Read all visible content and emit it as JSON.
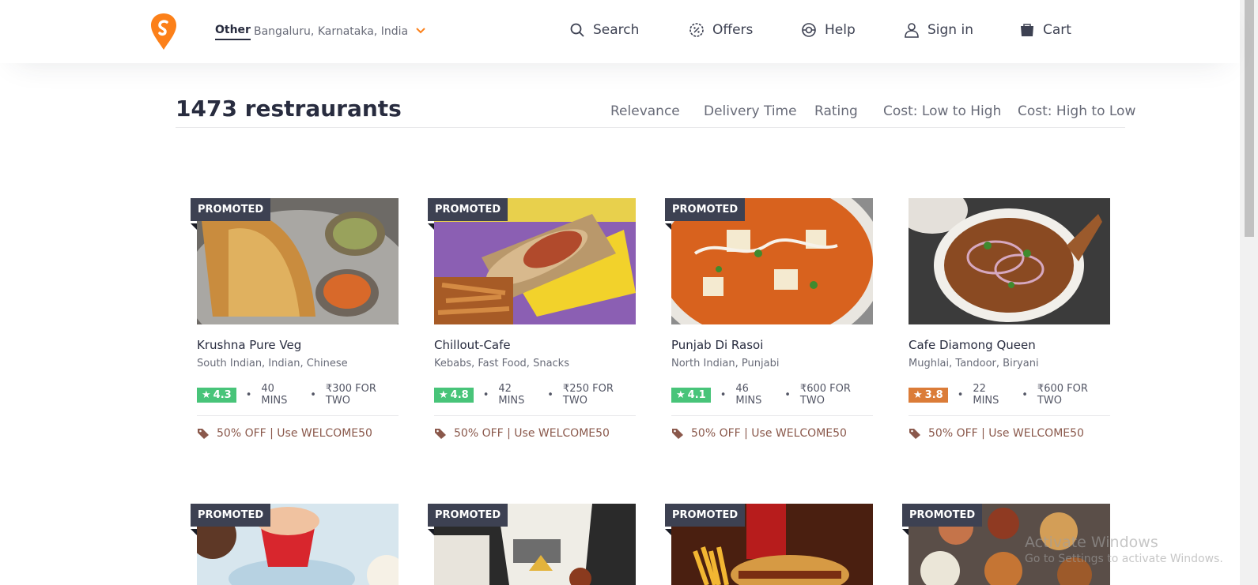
{
  "header": {
    "location_type": "Other",
    "location_text": "Bangaluru, Karnataka, India",
    "nav": [
      {
        "label": "Search",
        "icon": "search-icon"
      },
      {
        "label": "Offers",
        "icon": "offers-icon"
      },
      {
        "label": "Help",
        "icon": "help-icon"
      },
      {
        "label": "Sign in",
        "icon": "user-icon"
      },
      {
        "label": "Cart",
        "icon": "cart-icon"
      }
    ]
  },
  "listing": {
    "count_title": "1473 restraurants",
    "sort_options": [
      "Relevance",
      "Delivery Time",
      "Rating",
      "Cost: Low to High",
      "Cost: High to Low"
    ]
  },
  "colors": {
    "brand": "#fc8019",
    "rating_green": "#48c479",
    "rating_orange": "#db7c38",
    "promo_bg": "#3d4152"
  },
  "restaurants": [
    {
      "promoted_label": "PROMOTED",
      "name": "Krushna Pure Veg",
      "cuisines": "South Indian, Indian, Chinese",
      "rating": "4.3",
      "time": "40 MINS",
      "cost": "₹300 FOR TWO",
      "offer": "50% OFF | Use WELCOME50",
      "rating_color": "#48c479"
    },
    {
      "promoted_label": "PROMOTED",
      "name": "Chillout-Cafe",
      "cuisines": "Kebabs, Fast Food, Snacks",
      "rating": "4.8",
      "time": "42 MINS",
      "cost": "₹250 FOR TWO",
      "offer": "50% OFF | Use WELCOME50",
      "rating_color": "#48c479"
    },
    {
      "promoted_label": "PROMOTED",
      "name": "Punjab Di Rasoi",
      "cuisines": "North Indian, Punjabi",
      "rating": "4.1",
      "time": "46 MINS",
      "cost": "₹600 FOR TWO",
      "offer": "50% OFF | Use WELCOME50",
      "rating_color": "#48c479"
    },
    {
      "promoted_label": "",
      "name": "Cafe Diamong Queen",
      "cuisines": "Mughlai, Tandoor, Biryani",
      "rating": "3.8",
      "time": "22 MINS",
      "cost": "₹600 FOR TWO",
      "offer": "50% OFF | Use WELCOME50",
      "rating_color": "#db7c38"
    },
    {
      "promoted_label": "PROMOTED"
    },
    {
      "promoted_label": "PROMOTED"
    },
    {
      "promoted_label": "PROMOTED"
    },
    {
      "promoted_label": "PROMOTED"
    }
  ],
  "os_watermark": {
    "line1": "Activate Windows",
    "line2": "Go to Settings to activate Windows."
  }
}
